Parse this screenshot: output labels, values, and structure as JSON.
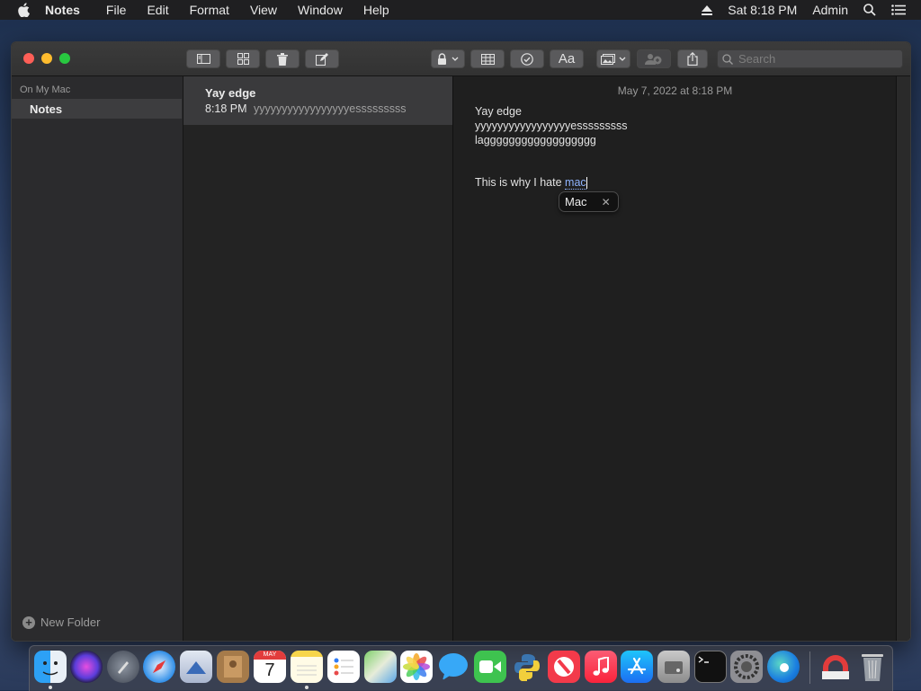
{
  "menubar": {
    "app_name": "Notes",
    "menus": [
      "File",
      "Edit",
      "Format",
      "View",
      "Window",
      "Help"
    ],
    "clock": "Sat 8:18 PM",
    "user": "Admin"
  },
  "toolbar": {
    "search_placeholder": "Search",
    "format_label": "Aa"
  },
  "sidebar": {
    "section_label": "On My Mac",
    "folder_label": "Notes",
    "new_folder_label": "New Folder"
  },
  "notelist": {
    "notes": [
      {
        "title": "Yay edge",
        "time": "8:18 PM",
        "preview": "yyyyyyyyyyyyyyyyyesssssssss"
      }
    ]
  },
  "editor": {
    "date": "May 7, 2022 at 8:18 PM",
    "lines": [
      "Yay edge",
      "yyyyyyyyyyyyyyyyyesssssssss",
      "lagggggggggggggggggg"
    ],
    "sentence_prefix": "This is why I hate ",
    "marked_text": "mac",
    "suggestion": "Mac"
  },
  "dock": {
    "apps": [
      "finder-icon",
      "siri-icon",
      "launchpad-icon",
      "safari-icon",
      "mail-icon",
      "contacts-icon",
      "calendar-icon",
      "notes-icon",
      "reminders-icon",
      "maps-icon",
      "photos-icon",
      "messages-icon",
      "facetime-icon",
      "python-icon",
      "news-icon",
      "music-icon",
      "app-store-icon",
      "disk-utility-icon",
      "terminal-icon",
      "system-preferences-icon",
      "edge-icon",
      "downloads-icon",
      "trash-icon"
    ],
    "calendar": {
      "month": "MAY",
      "day": "7"
    }
  }
}
